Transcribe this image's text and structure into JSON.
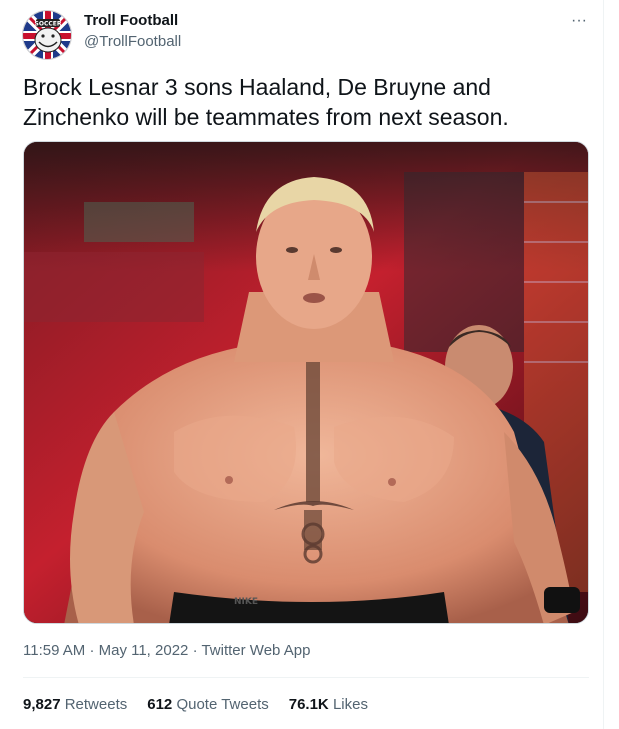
{
  "author": {
    "display_name": "Troll Football",
    "handle": "@TrollFootball",
    "avatar_text": "SOCCER",
    "avatar_icon": "troll-face-union-jack"
  },
  "more_icon": "···",
  "tweet": {
    "text": "Brock Lesnar 3 sons Haaland, De Bruyne and Zinchenko will be teammates from next season."
  },
  "media": {
    "watermark": "NIKE"
  },
  "meta": {
    "time": "11:59 AM",
    "dot1": "·",
    "date": "May 11, 2022",
    "dot2": "·",
    "source": "Twitter Web App"
  },
  "stats": {
    "retweets_count": "9,827",
    "retweets_label": "Retweets",
    "quotes_count": "612",
    "quotes_label": "Quote Tweets",
    "likes_count": "76.1K",
    "likes_label": "Likes"
  },
  "colors": {
    "text_primary": "#0f1419",
    "text_secondary": "#536471",
    "divider": "#eff3f4"
  }
}
